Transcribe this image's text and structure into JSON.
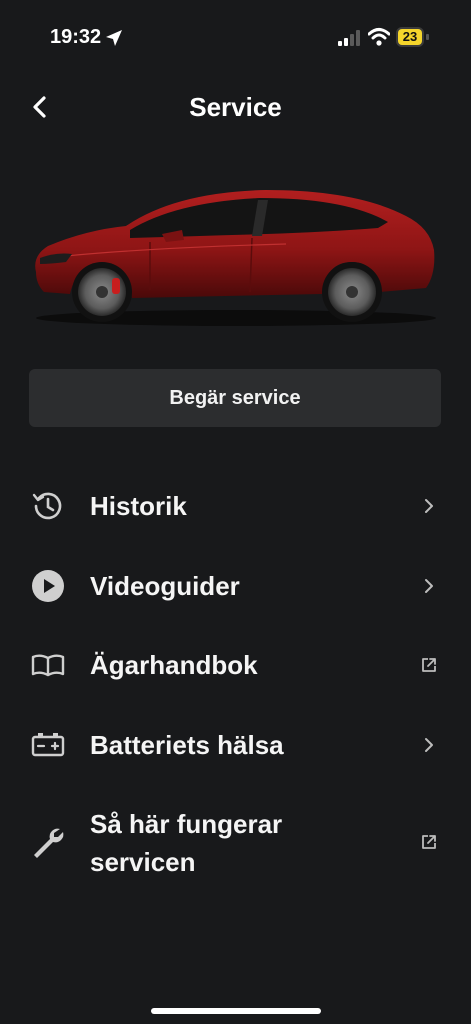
{
  "status_bar": {
    "time": "19:32",
    "battery_level": "23"
  },
  "header": {
    "title": "Service"
  },
  "request_button": {
    "label": "Begär service"
  },
  "menu": [
    {
      "label": "Historik",
      "icon": "history-icon",
      "action": "chevron-right-icon"
    },
    {
      "label": "Videoguider",
      "icon": "play-circle-icon",
      "action": "chevron-right-icon"
    },
    {
      "label": "Ägarhandbok",
      "icon": "open-book-icon",
      "action": "external-link-icon"
    },
    {
      "label": "Batteriets hälsa",
      "icon": "battery-icon",
      "action": "chevron-right-icon"
    },
    {
      "label_line1": "Så här fungerar",
      "label_line2": "servicen",
      "icon": "wrench-icon",
      "action": "external-link-icon"
    }
  ],
  "colors": {
    "background": "#18191b",
    "button": "#2c2d2f",
    "car": "#8e1515",
    "battery": "#f5d52c"
  }
}
